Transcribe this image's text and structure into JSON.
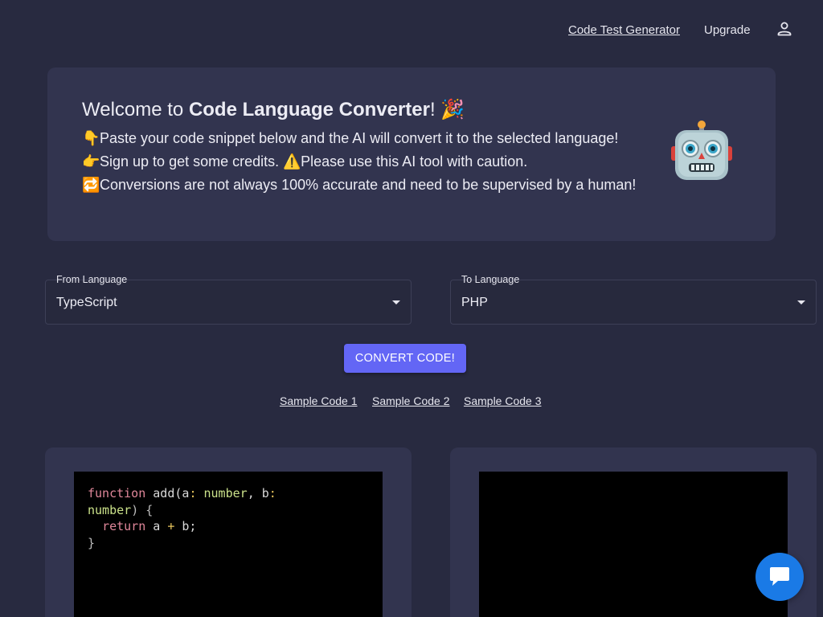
{
  "nav": {
    "code_test_generator": "Code Test Generator",
    "upgrade": "Upgrade"
  },
  "welcome": {
    "title_prefix": "Welcome to ",
    "title_bold": "Code Language Converter",
    "title_suffix": "! 🎉",
    "line1_emoji": "👇",
    "line1": "Paste your code snippet below and the AI will convert it to the selected language!",
    "line2_emoji": "👉",
    "line2a": "Sign up to get some credits. ",
    "line2_emoji2": "⚠️",
    "line2b": "Please use this AI tool with caution.",
    "line3_emoji": "🔁",
    "line3": "Conversions are not always 100% accurate and need to be supervised by a human!"
  },
  "from_select": {
    "label": "From Language",
    "value": "TypeScript"
  },
  "to_select": {
    "label": "To Language",
    "value": "PHP"
  },
  "convert_button": "CONVERT CODE!",
  "samples": [
    "Sample Code 1",
    "Sample Code 2",
    "Sample Code 3"
  ],
  "code_input": {
    "tokens": {
      "kw_function": "function",
      "fn_name": " add(a",
      "colon1": ": ",
      "type1": "number",
      "comma": ", b",
      "colon2": ":",
      "type2": "number",
      "close": ") {",
      "indent": "  ",
      "kw_return": "return",
      "expr_a": " a ",
      "plus": "+",
      "expr_b": " b;",
      "closing_brace": "}"
    }
  },
  "colors": {
    "background": "#282a40",
    "card": "#32344f",
    "accent": "#6366f5",
    "chat": "#1a7ae6"
  },
  "icons": {
    "user": "user-icon",
    "robot": "robot-icon",
    "caret": "caret-down-icon",
    "chat": "chat-bubble-icon"
  }
}
